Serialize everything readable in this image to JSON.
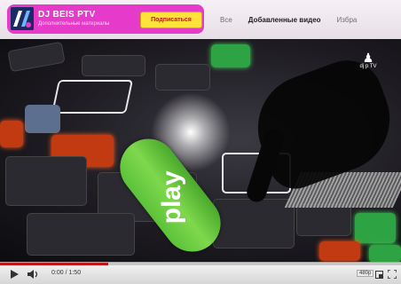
{
  "header": {
    "channel_name": "DJ BEIS PTV",
    "channel_sub": "Дополнительные материалы",
    "subscribe_label": "Подписаться",
    "tabs": [
      {
        "label": "Все"
      },
      {
        "label": "Добавленные видео"
      },
      {
        "label": "Избра"
      }
    ],
    "active_tab": 1
  },
  "video": {
    "overlay_label": "play",
    "watermark_icon": "person-icon",
    "watermark_text": "dj p TV",
    "colors": {
      "pill": "#6cc83f",
      "pad_green": "#2ea343",
      "pad_orange": "#c23a12"
    }
  },
  "player": {
    "time": "0:00 / 1:50",
    "progress": 0.27,
    "quality": "480p",
    "icons": [
      "play-icon",
      "volume-icon",
      "popout-icon",
      "fullscreen-icon"
    ],
    "accent": "#c0171b"
  }
}
